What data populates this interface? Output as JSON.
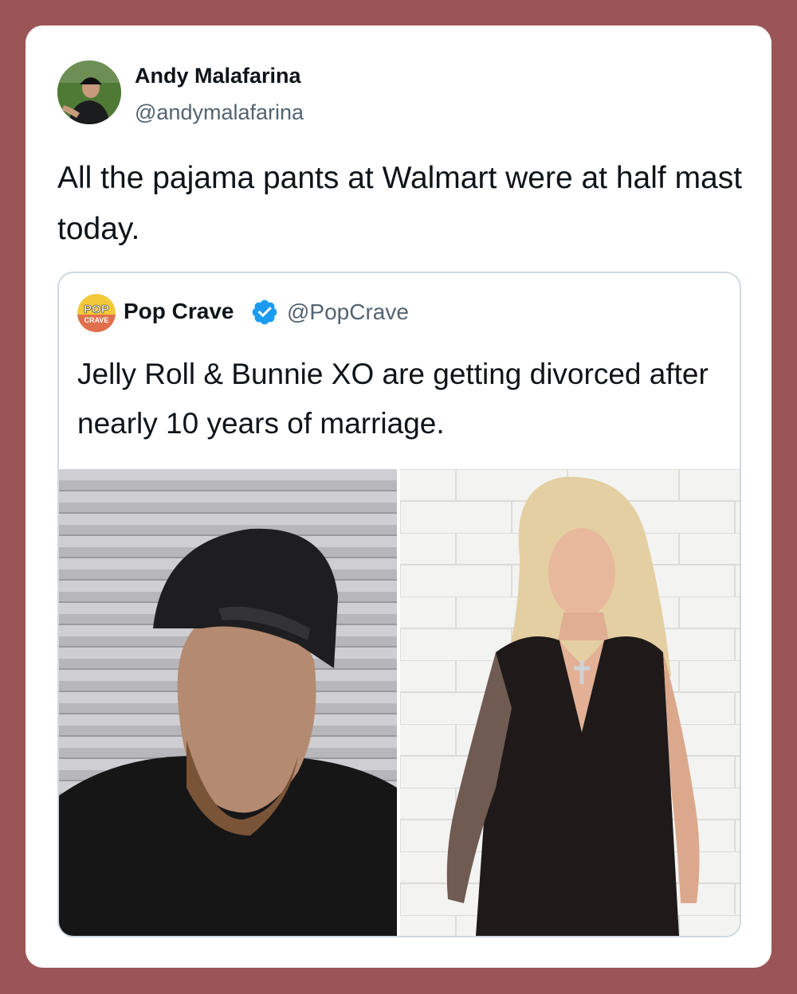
{
  "tweet": {
    "author_name": "Andy Malafarina",
    "author_handle": "@andymalafarina",
    "text": "All the pajama pants at Walmart were at half mast today."
  },
  "quoted_tweet": {
    "logo_text_top": "POP",
    "logo_text_bottom": "CRAVE",
    "author_name": "Pop Crave",
    "verified": true,
    "author_handle": "@PopCrave",
    "text": "Jelly Roll & Bunnie XO are getting divorced after nearly 10 years of marriage."
  },
  "colors": {
    "page_background": "#9b5556",
    "card_background": "#ffffff",
    "verified_badge": "#1d9bf0",
    "secondary_text": "#536471"
  }
}
